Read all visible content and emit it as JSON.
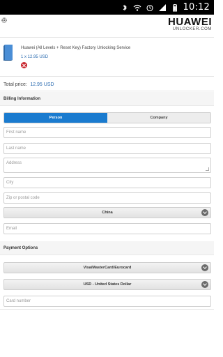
{
  "status": {
    "time": "10:12",
    "icons": [
      "bluetooth-icon",
      "wifi-icon",
      "alarm-icon",
      "signal-icon",
      "battery-icon"
    ]
  },
  "header": {
    "logo_main": "HUAWEI",
    "logo_sub": "UNLOCKER.COM"
  },
  "cart": {
    "item_title": "Huawei (All Levels + Reset Key) Factory Unlocking Service",
    "item_price": "1 x 12.95 USD",
    "total_label": "Total price:",
    "total_value": "12.95 USD"
  },
  "billing": {
    "section_title": "Billing Information",
    "tabs": [
      {
        "label": "Person",
        "active": true
      },
      {
        "label": "Company",
        "active": false
      }
    ],
    "fields": {
      "first_name": "First name",
      "last_name": "Last name",
      "address": "Address",
      "city": "City",
      "zip": "Zip or postal code",
      "email": "Email"
    },
    "country": "China"
  },
  "payment": {
    "section_title": "Payment Options",
    "method": "Visa/MasterCard/Eurocard",
    "currency": "USD - United States Dollar",
    "card_number": "Card number"
  },
  "colors": {
    "accent": "#1a7bcf",
    "price": "#2a6bb0",
    "remove": "#c8262e"
  }
}
